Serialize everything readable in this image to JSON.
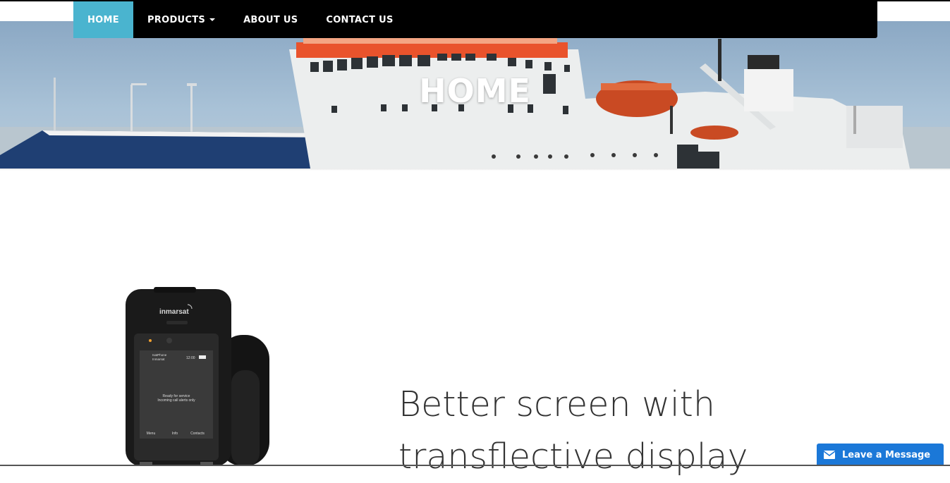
{
  "nav": {
    "items": [
      {
        "label": "HOME",
        "active": true
      },
      {
        "label": "PRODUCTS",
        "dropdown": true
      },
      {
        "label": "ABOUT US"
      },
      {
        "label": "CONTACT US"
      }
    ]
  },
  "hero": {
    "title": "HOME"
  },
  "feature": {
    "headline": "Better screen with transflective display"
  },
  "phone": {
    "brand": "inmarsat",
    "screen_line1": "IsatPhone",
    "screen_line2": "Inmarsat",
    "time": "12:00",
    "status1": "Ready for service",
    "status2": "Incoming call alerts only",
    "softkeys": [
      "Menu",
      "Info",
      "Contacts"
    ]
  },
  "chat": {
    "label": "Leave a Message"
  },
  "colors": {
    "nav_bg": "#000000",
    "nav_active": "#4ab4cf",
    "chat_bg": "#1b78d8"
  }
}
